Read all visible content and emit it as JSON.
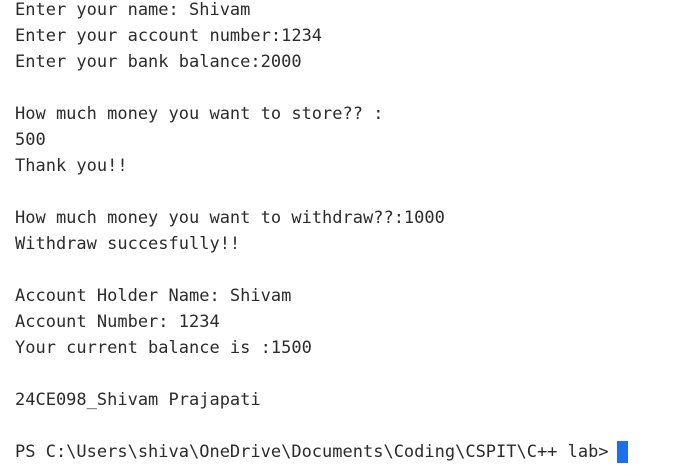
{
  "terminal": {
    "lines": [
      "Enter your name: Shivam",
      "Enter your account number:1234",
      "Enter your bank balance:2000",
      "",
      "How much money you want to store?? :",
      "500",
      "Thank you!!",
      "",
      "How much money you want to withdraw??:1000",
      "Withdraw succesfully!!",
      "",
      "Account Holder Name: Shivam",
      "Account Number: 1234",
      "Your current balance is :1500",
      "",
      "24CE098_Shivam Prajapati",
      ""
    ],
    "prompt": "PS C:\\Users\\shiva\\OneDrive\\Documents\\Coding\\CSPIT\\C++ lab>"
  },
  "colors": {
    "background": "#ffffff",
    "text": "#2b2b2b",
    "cursor": "#1f6feb"
  }
}
